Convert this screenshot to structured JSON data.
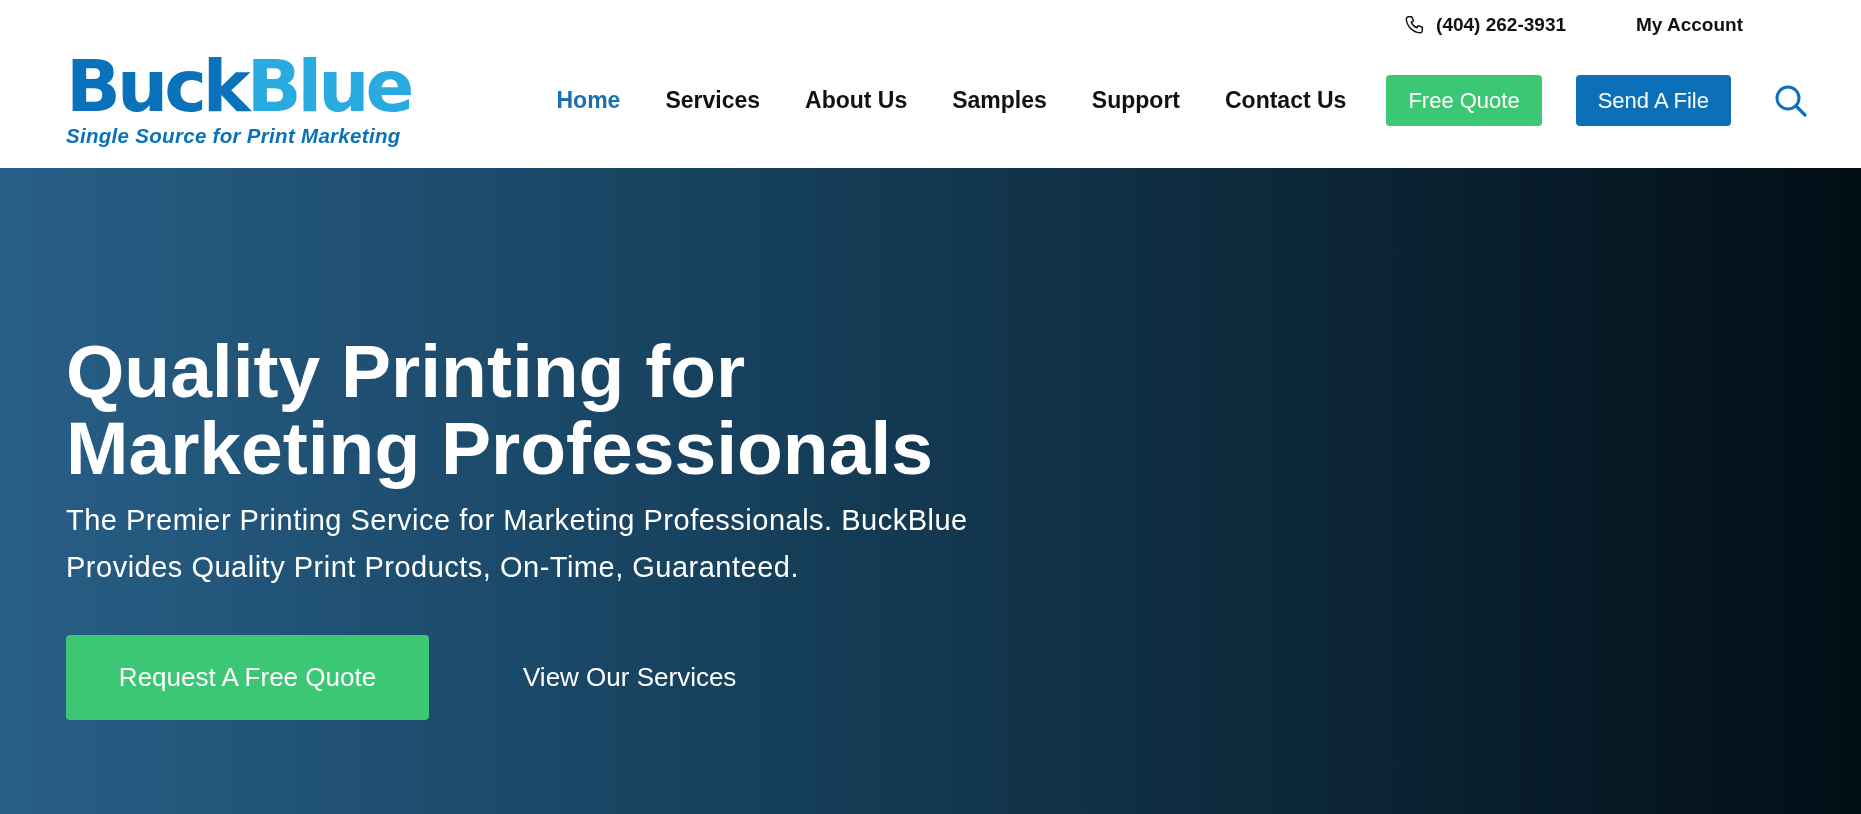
{
  "logo": {
    "parts": [
      {
        "text": "Buck",
        "color": "#0a72bb"
      },
      {
        "text": "Blue",
        "color": "#29abe2"
      }
    ],
    "tagline": "Single Source for Print Marketing"
  },
  "top_bar": {
    "phone": "(404) 262-3931",
    "account": "My Account"
  },
  "nav": [
    {
      "label": "Home",
      "selected": true
    },
    {
      "label": "Services",
      "selected": false
    },
    {
      "label": "About Us",
      "selected": false
    },
    {
      "label": "Samples",
      "selected": false
    },
    {
      "label": "Support",
      "selected": false
    },
    {
      "label": "Contact Us",
      "selected": false
    }
  ],
  "header_buttons": [
    {
      "label": "Free Quote",
      "kind": "green"
    },
    {
      "label": "Send A File",
      "kind": "blue"
    }
  ],
  "hero": {
    "title_lines": [
      "Quality Printing for",
      "Marketing Professionals"
    ],
    "subtitle": "The Premier Printing Service for Marketing Professionals. BuckBlue Provides Quality Print Products, On-Time, Guaranteed.",
    "primary_button": "Request A Free Quote",
    "secondary_link": "View Our Services"
  }
}
